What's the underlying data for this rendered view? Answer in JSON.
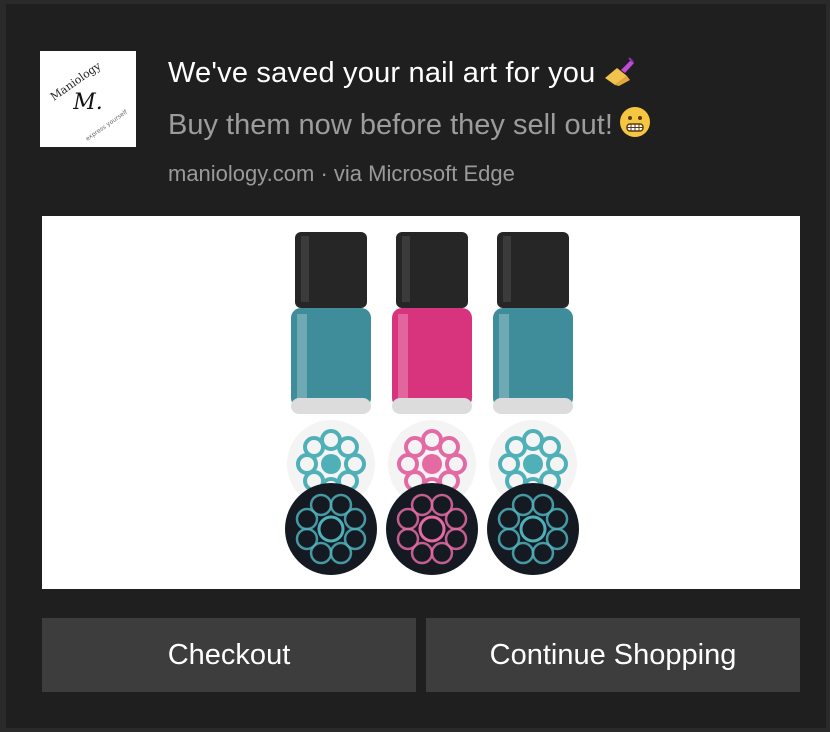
{
  "notification": {
    "title": "We've saved your nail art for you",
    "body": "Buy them now before they sell out!",
    "source": "maniology.com",
    "separator": "·",
    "via": "via Microsoft Edge"
  },
  "logo": {
    "brand_text": "Maniology",
    "mark": "M.",
    "tagline": "express yourself"
  },
  "hero": {
    "bottles": [
      {
        "color": "#3f8c9a"
      },
      {
        "color": "#d8337d"
      },
      {
        "color": "#3f8c9a"
      }
    ],
    "plates": [
      {
        "color": "#4fb0b8"
      },
      {
        "color": "#e36aa3"
      },
      {
        "color": "#4fb0b8"
      }
    ]
  },
  "actions": {
    "checkout_label": "Checkout",
    "continue_label": "Continue Shopping"
  },
  "icons": {
    "title_emoji": "nail-polish-icon",
    "body_emoji": "grimacing-face-icon"
  }
}
